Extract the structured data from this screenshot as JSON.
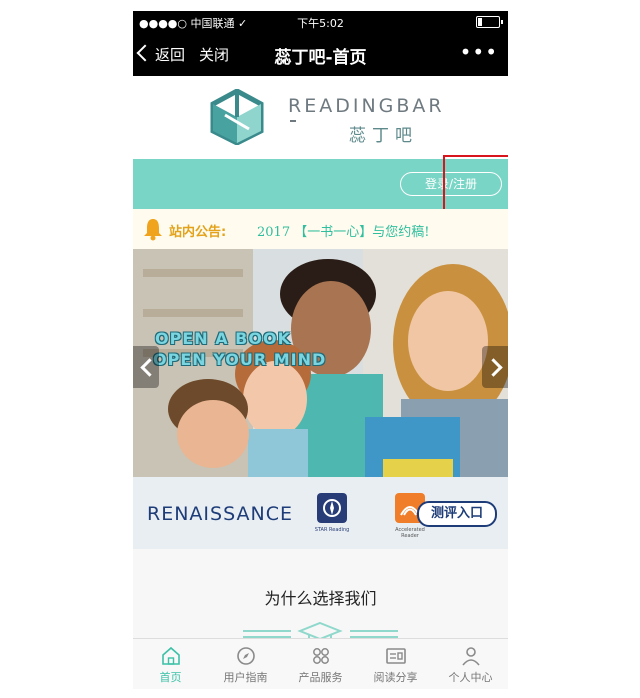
{
  "status_bar": {
    "carrier": "●●●●○ 中国联通 ✓",
    "time": "下午5:02",
    "battery_level": 0.2
  },
  "nav": {
    "back_label": "返回",
    "close_label": "关闭",
    "title": "蕊丁吧-首页",
    "more_label": "•••"
  },
  "logo": {
    "name_en": "READINGBAR",
    "name_cn": "蕊丁吧"
  },
  "login": {
    "label": "登录/注册"
  },
  "announcement": {
    "label": "站内公告:",
    "text": "2017 【一书一心】与您约稿!"
  },
  "banner": {
    "slogan_line1": "OPEN A BOOK",
    "slogan_line2": "OPEN YOUR MIND",
    "brand": "RENAISSANCE",
    "star_caption": "STAR Reading",
    "ar_caption": "Accelerated Reader",
    "test_button": "测评入口"
  },
  "why": {
    "title": "为什么选择我们"
  },
  "tabs": [
    {
      "label": "首页",
      "icon": "home-icon",
      "active": true
    },
    {
      "label": "用户指南",
      "icon": "compass-icon",
      "active": false
    },
    {
      "label": "产品服务",
      "icon": "grid-icon",
      "active": false
    },
    {
      "label": "阅读分享",
      "icon": "share-card-icon",
      "active": false
    },
    {
      "label": "个人中心",
      "icon": "user-icon",
      "active": false
    }
  ],
  "colors": {
    "teal": "#79d5c5",
    "accent": "#3cc1a7",
    "highlight": "#d8141c",
    "navy": "#1d3c78"
  }
}
